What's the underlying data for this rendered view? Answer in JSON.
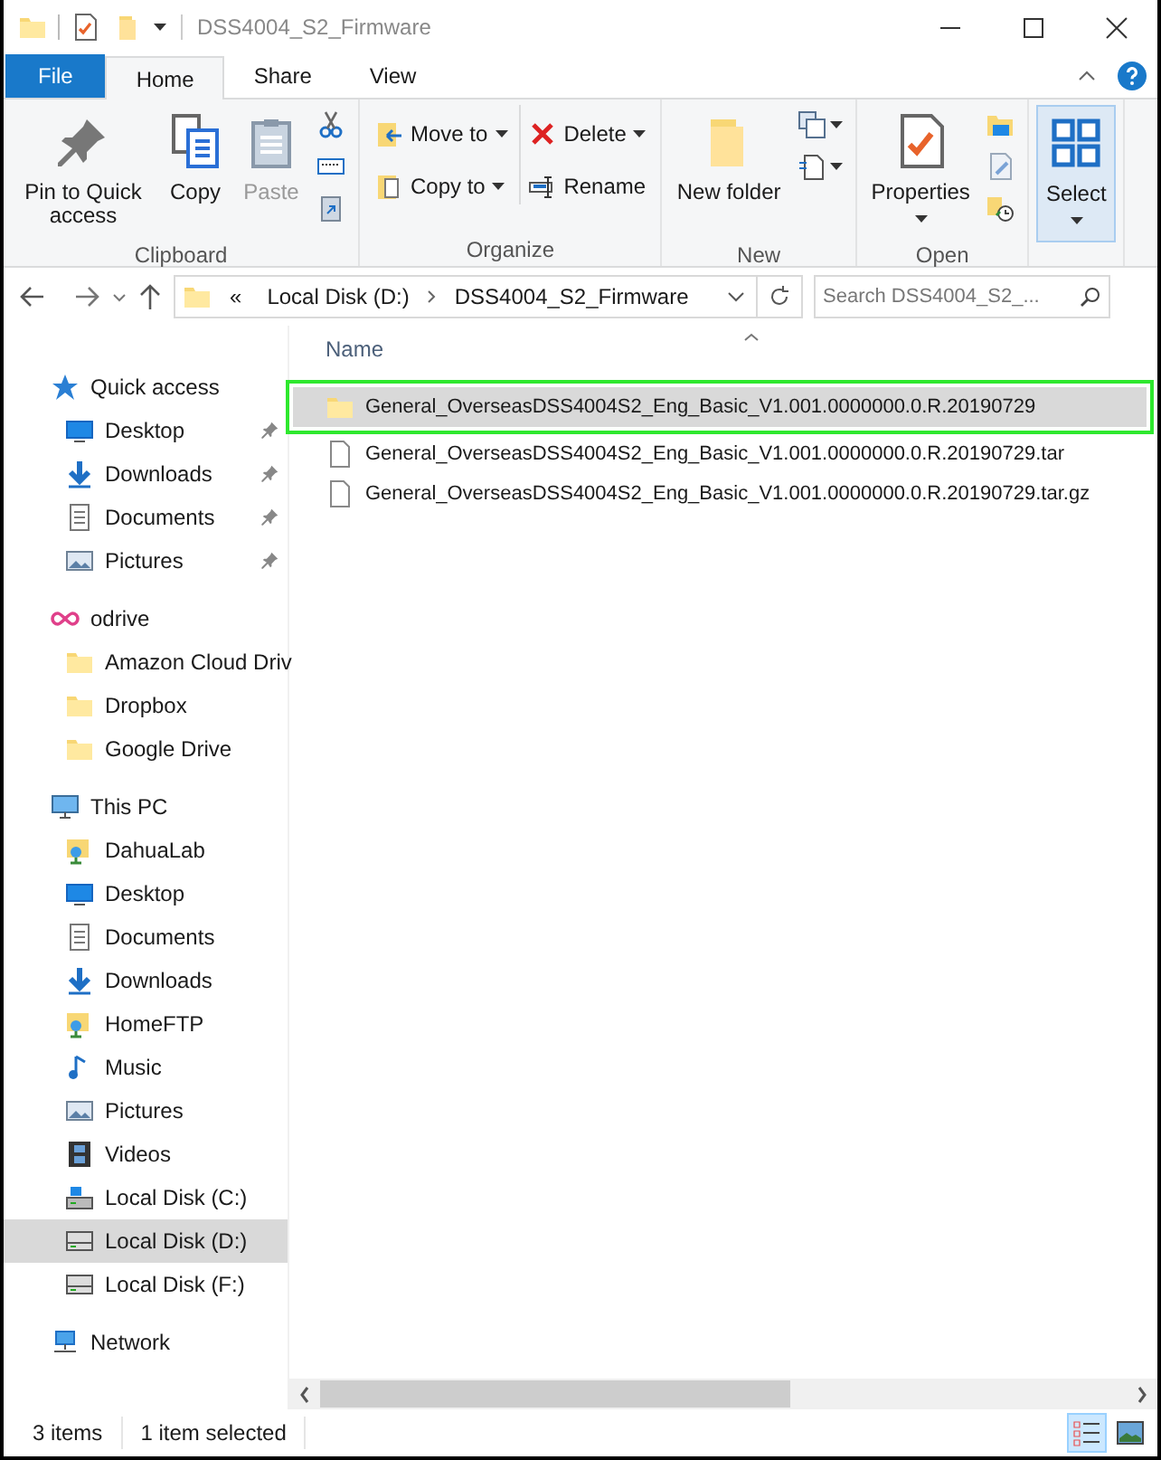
{
  "window": {
    "title": "DSS4004_S2_Firmware"
  },
  "tabs": [
    {
      "label": "File",
      "kind": "file",
      "selected": false
    },
    {
      "label": "Home",
      "kind": "tab",
      "selected": true
    },
    {
      "label": "Share",
      "kind": "tab",
      "selected": false
    },
    {
      "label": "View",
      "kind": "tab",
      "selected": false
    }
  ],
  "ribbon": [
    {
      "label": "Clipboard",
      "items": [
        {
          "kind": "large",
          "label": "Pin to Quick access",
          "disabled": false
        },
        {
          "kind": "large",
          "label": "Copy",
          "disabled": false
        },
        {
          "kind": "large",
          "label": "Paste",
          "disabled": true
        },
        {
          "kind": "stack"
        }
      ]
    },
    {
      "label": "Organize",
      "items": [
        {
          "kind": "column",
          "buttons": [
            {
              "label": "Move to",
              "dropdown": true
            },
            {
              "label": "Copy to",
              "dropdown": true
            }
          ]
        },
        {
          "kind": "column",
          "buttons": [
            {
              "label": "Delete",
              "dropdown": true
            },
            {
              "label": "Rename",
              "dropdown": false
            }
          ]
        }
      ]
    },
    {
      "label": "New",
      "items": [
        {
          "kind": "large",
          "label": "New folder",
          "disabled": false
        },
        {
          "kind": "stackdrop"
        }
      ]
    },
    {
      "label": "Open",
      "items": [
        {
          "kind": "large",
          "label": "Properties",
          "disabled": false,
          "dropdown": true
        },
        {
          "kind": "stack"
        }
      ]
    },
    {
      "items": [
        {
          "kind": "large",
          "label": "Select",
          "disabled": false,
          "dropdown": true
        }
      ]
    }
  ],
  "address": {
    "path": [
      "«",
      "Local Disk (D:)",
      "DSS4004_S2_Firmware"
    ],
    "search_placeholder": "Search DSS4004_S2_..."
  },
  "sidebar": [
    {
      "label": "Quick access",
      "kind": "star",
      "selected": false,
      "children": [
        {
          "label": "Desktop",
          "kind": "desktop",
          "selected": false,
          "pinned": true
        },
        {
          "label": "Downloads",
          "kind": "download",
          "selected": false,
          "pinned": true
        },
        {
          "label": "Documents",
          "kind": "documents",
          "selected": false,
          "pinned": true
        },
        {
          "label": "Pictures",
          "kind": "pictures",
          "selected": false,
          "pinned": true
        }
      ]
    },
    {
      "label": "odrive",
      "kind": "odrive",
      "selected": false,
      "children": [
        {
          "label": "Amazon Cloud Driv",
          "kind": "folder",
          "selected": false,
          "pinned": false
        },
        {
          "label": "Dropbox",
          "kind": "folder",
          "selected": false,
          "pinned": false
        },
        {
          "label": "Google Drive",
          "kind": "folder",
          "selected": false,
          "pinned": false
        }
      ]
    },
    {
      "label": "This PC",
      "kind": "pc",
      "selected": false,
      "children": [
        {
          "label": "DahuaLab",
          "kind": "share",
          "selected": false,
          "pinned": false
        },
        {
          "label": "Desktop",
          "kind": "desktop",
          "selected": false,
          "pinned": false
        },
        {
          "label": "Documents",
          "kind": "documents",
          "selected": false,
          "pinned": false
        },
        {
          "label": "Downloads",
          "kind": "download",
          "selected": false,
          "pinned": false
        },
        {
          "label": "HomeFTP",
          "kind": "share",
          "selected": false,
          "pinned": false
        },
        {
          "label": "Music",
          "kind": "music",
          "selected": false,
          "pinned": false
        },
        {
          "label": "Pictures",
          "kind": "pictures",
          "selected": false,
          "pinned": false
        },
        {
          "label": "Videos",
          "kind": "videos",
          "selected": false,
          "pinned": false
        },
        {
          "label": "Local Disk (C:)",
          "kind": "sysdrive",
          "selected": false,
          "pinned": false
        },
        {
          "label": "Local Disk (D:)",
          "kind": "drive",
          "selected": true,
          "pinned": false
        },
        {
          "label": "Local Disk (F:)",
          "kind": "drive",
          "selected": false,
          "pinned": false
        }
      ]
    },
    {
      "label": "Network",
      "kind": "network",
      "selected": false
    }
  ],
  "files": {
    "column": "Name",
    "rows": [
      {
        "name": "General_OverseasDSS4004S2_Eng_Basic_V1.001.0000000.0.R.20190729",
        "kind": "folder",
        "selected": true
      },
      {
        "name": "General_OverseasDSS4004S2_Eng_Basic_V1.001.0000000.0.R.20190729.tar",
        "kind": "file",
        "selected": false
      },
      {
        "name": "General_OverseasDSS4004S2_Eng_Basic_V1.001.0000000.0.R.20190729.tar.gz",
        "kind": "file",
        "selected": false
      }
    ]
  },
  "status_bar": {
    "count": "3 items",
    "selection": "1 item selected",
    "views": [
      {
        "kind": "details",
        "selected": true
      },
      {
        "kind": "large",
        "selected": false
      }
    ]
  }
}
